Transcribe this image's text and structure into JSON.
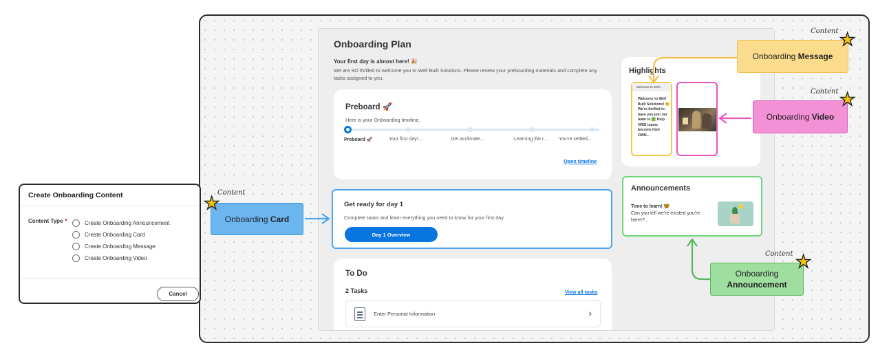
{
  "dialog": {
    "title": "Create Onboarding Content",
    "content_type_label": "Content Type",
    "required_mark": "*",
    "options": [
      "Create Onboarding Announcement",
      "Create Onboarding Card",
      "Create Onboarding Message",
      "Create Onboarding Video"
    ],
    "cancel_label": "Cancel"
  },
  "plan": {
    "title": "Onboarding Plan",
    "welcome_heading": "Your first day is almost here! 🎉",
    "welcome_text": "We are SO thrilled to welcome you to Well Built Solutions. Please review your preboarding materials and complete any tasks assigned to you."
  },
  "preboard": {
    "title": "Preboard 🚀",
    "subtitle": "Here is your Onboarding timeline.",
    "steps": [
      "Preboard 🚀",
      "Your first day!...",
      "Get acclimate...",
      "Learning the r...",
      "You're settled..."
    ],
    "link": "Open timeline"
  },
  "day1": {
    "title": "Get ready for day 1",
    "text": "Complete tasks and learn everything you need to know for your first day.",
    "button": "Day 1 Overview"
  },
  "todo": {
    "title": "To Do",
    "count": "2 Tasks",
    "link": "View all tasks",
    "tasks": [
      "Enter Personal Information"
    ]
  },
  "highlights": {
    "title": "Highlights",
    "message_header": "Welcome to Well...",
    "message_text": "Welcome to Well Built Solutions! 😊 We're thrilled to have you join our team to 🟩 Help HRIS teams become their OWN..."
  },
  "announcements": {
    "title": "Announcements",
    "item_title": "Time to learn! 🤓",
    "item_text": "Can you tell we're excited you're here!?..."
  },
  "callouts": {
    "message_pre": "Onboarding ",
    "message_bold": "Message",
    "video_pre": "Onboarding ",
    "video_bold": "Video",
    "card_pre": "Onboarding ",
    "card_bold": "Card",
    "announcement_pre": "Onboarding",
    "announcement_bold": "Announcement",
    "tag": "Content"
  },
  "colors": {
    "accent_blue": "#0875e1",
    "message": "#fbdc8c",
    "video": "#f391d7",
    "card": "#6cb6f0",
    "announcement": "#9ede9f"
  }
}
